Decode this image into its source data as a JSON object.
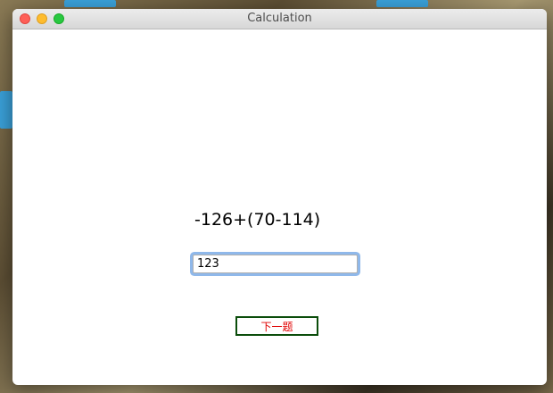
{
  "window": {
    "title": "Calculation"
  },
  "quiz": {
    "question": "-126+(70-114)",
    "answer_value": "123",
    "next_label": "下一题"
  },
  "colors": {
    "next_text": "#e00000",
    "next_border": "#0b4d0b",
    "focus_ring": "#8fb8ea"
  }
}
